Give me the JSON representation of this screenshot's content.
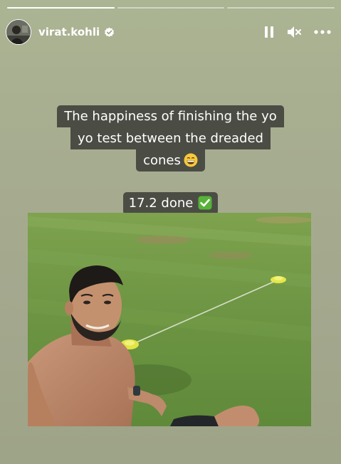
{
  "story": {
    "progress": {
      "segments": 3,
      "current_segment_fraction": 1.0
    },
    "user": {
      "username": "virat.kohli",
      "verified": true
    },
    "controls": {
      "pause": "pause-icon",
      "mute": "muted-speaker-icon",
      "more": "more-icon"
    },
    "caption_lines": [
      "The happiness of finishing the yo",
      "yo test between the dreaded",
      "cones"
    ],
    "caption_emoji": "grinning-face-emoji",
    "score_text": "17.2 done",
    "score_emoji": "check-mark-button-emoji",
    "photo": "selfie-on-grass-field"
  },
  "colors": {
    "background": "#a7ad90",
    "caption_bg": "#4b4d44",
    "grass": "#6f9a45"
  }
}
